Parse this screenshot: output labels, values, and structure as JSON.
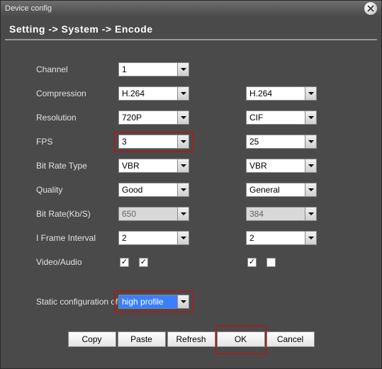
{
  "window": {
    "title": "Device config"
  },
  "breadcrumb": "Setting -> System -> Encode",
  "labels": {
    "channel": "Channel",
    "compression": "Compression",
    "resolution": "Resolution",
    "fps": "FPS",
    "bitrate_type": "Bit Rate Type",
    "quality": "Quality",
    "bitrate": "Bit Rate(Kb/S)",
    "iframe": "I Frame Interval",
    "video_audio": "Video/Audio",
    "static_cfg": "Static configuration of"
  },
  "main": {
    "channel": "1",
    "compression": "H.264",
    "resolution": "720P",
    "fps": "3",
    "bitrate_type": "VBR",
    "quality": "Good",
    "bitrate": "650",
    "iframe": "2",
    "video": true,
    "audio": true
  },
  "sub": {
    "compression": "H.264",
    "resolution": "CIF",
    "fps": "25",
    "bitrate_type": "VBR",
    "quality": "General",
    "bitrate": "384",
    "iframe": "2",
    "video": true,
    "audio": false
  },
  "static_cfg_value": "high profile",
  "buttons": {
    "copy": "Copy",
    "paste": "Paste",
    "refresh": "Refresh",
    "ok": "OK",
    "cancel": "Cancel"
  }
}
